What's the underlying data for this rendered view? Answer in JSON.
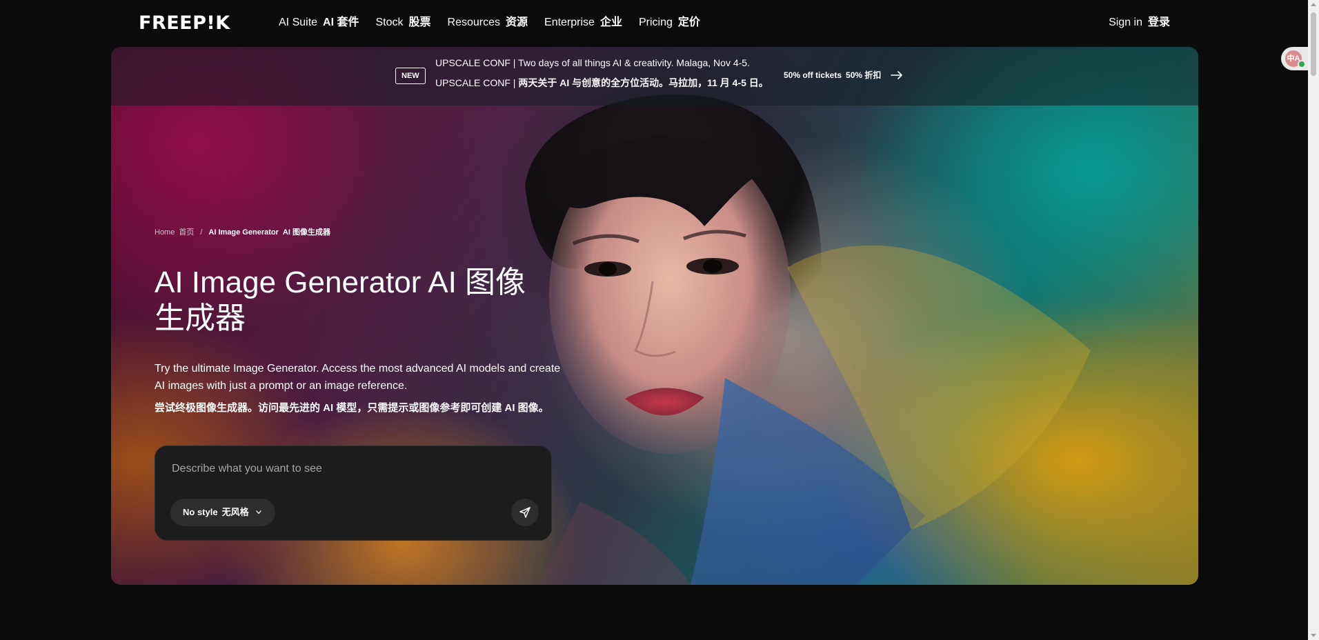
{
  "nav": {
    "logo": "FREEP!K",
    "items": [
      {
        "label": "AI Suite",
        "label_zh": "AI 套件"
      },
      {
        "label": "Stock",
        "label_zh": "股票"
      },
      {
        "label": "Resources",
        "label_zh": "资源"
      },
      {
        "label": "Enterprise",
        "label_zh": "企业"
      },
      {
        "label": "Pricing",
        "label_zh": "定价"
      }
    ],
    "signin": {
      "label": "Sign in",
      "label_zh": "登录"
    }
  },
  "extension": {
    "icon": "translate-extension-icon",
    "label": "中A"
  },
  "banner": {
    "badge": "NEW",
    "line_en": "UPSCALE CONF | Two days of all things AI & creativity. Malaga, Nov 4-5.",
    "line_zh_prefix": "UPSCALE CONF | ",
    "line_zh": "两天关于 AI 与创意的全方位活动。马拉加，11 月 4-5 日。",
    "cta": {
      "label": "50% off tickets",
      "label_zh": "50% 折扣",
      "icon": "arrow-right-icon"
    }
  },
  "breadcrumb": {
    "home": "Home",
    "home_zh": "首页",
    "separator": "/",
    "current": "AI Image Generator",
    "current_zh": "AI 图像生成器"
  },
  "hero": {
    "title": "AI Image Generator  AI 图像生成器",
    "description": "Try the ultimate Image Generator. Access the most advanced AI models and create AI images with just a prompt or an image reference.",
    "description_zh": "尝试终极图像生成器。访问最先进的 AI 模型，只需提示或图像参考即可创建 AI 图像。"
  },
  "prompt": {
    "placeholder": "Describe what you want to see",
    "value": "",
    "style": {
      "label": "No style",
      "label_zh": "无风格",
      "icon": "chevron-down-icon"
    },
    "send_icon": "send-icon"
  },
  "colors": {
    "page_background": "#0b0b0b",
    "prompt_background": "#1c1c1c",
    "control_background": "#2d2d2d",
    "text": "#ffffff",
    "placeholder": "#a6a6a6"
  }
}
